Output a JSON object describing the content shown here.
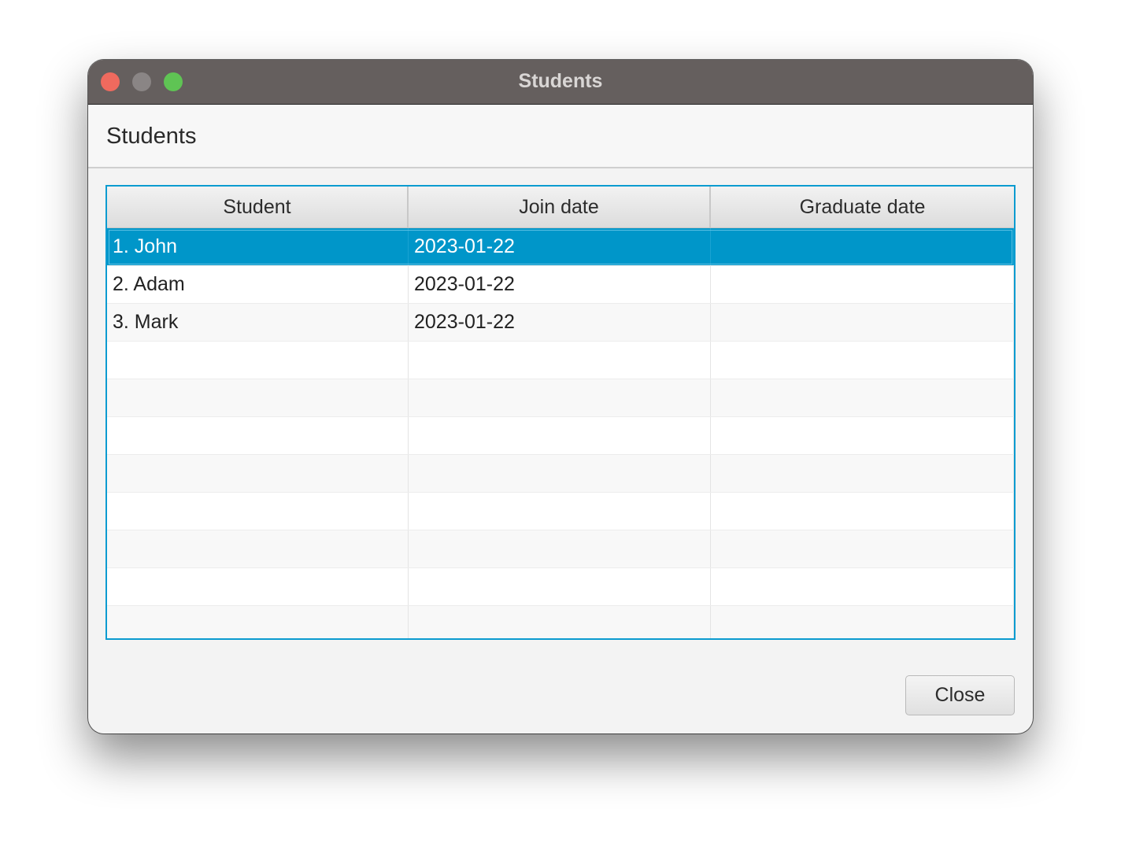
{
  "window": {
    "title": "Students",
    "traffic_lights": {
      "close": "#ef6a5e",
      "minimize": "#8a8585",
      "zoom": "#5fc454"
    }
  },
  "header": {
    "title": "Students"
  },
  "table": {
    "columns": [
      "Student",
      "Join date",
      "Graduate date"
    ],
    "rows": [
      [
        "1. John",
        "2023-01-22",
        ""
      ],
      [
        "2. Adam",
        "2023-01-22",
        ""
      ],
      [
        "3. Mark",
        "2023-01-22",
        ""
      ]
    ],
    "selected_row": 0,
    "accent": "#0096c9"
  },
  "footer": {
    "close_label": "Close"
  }
}
